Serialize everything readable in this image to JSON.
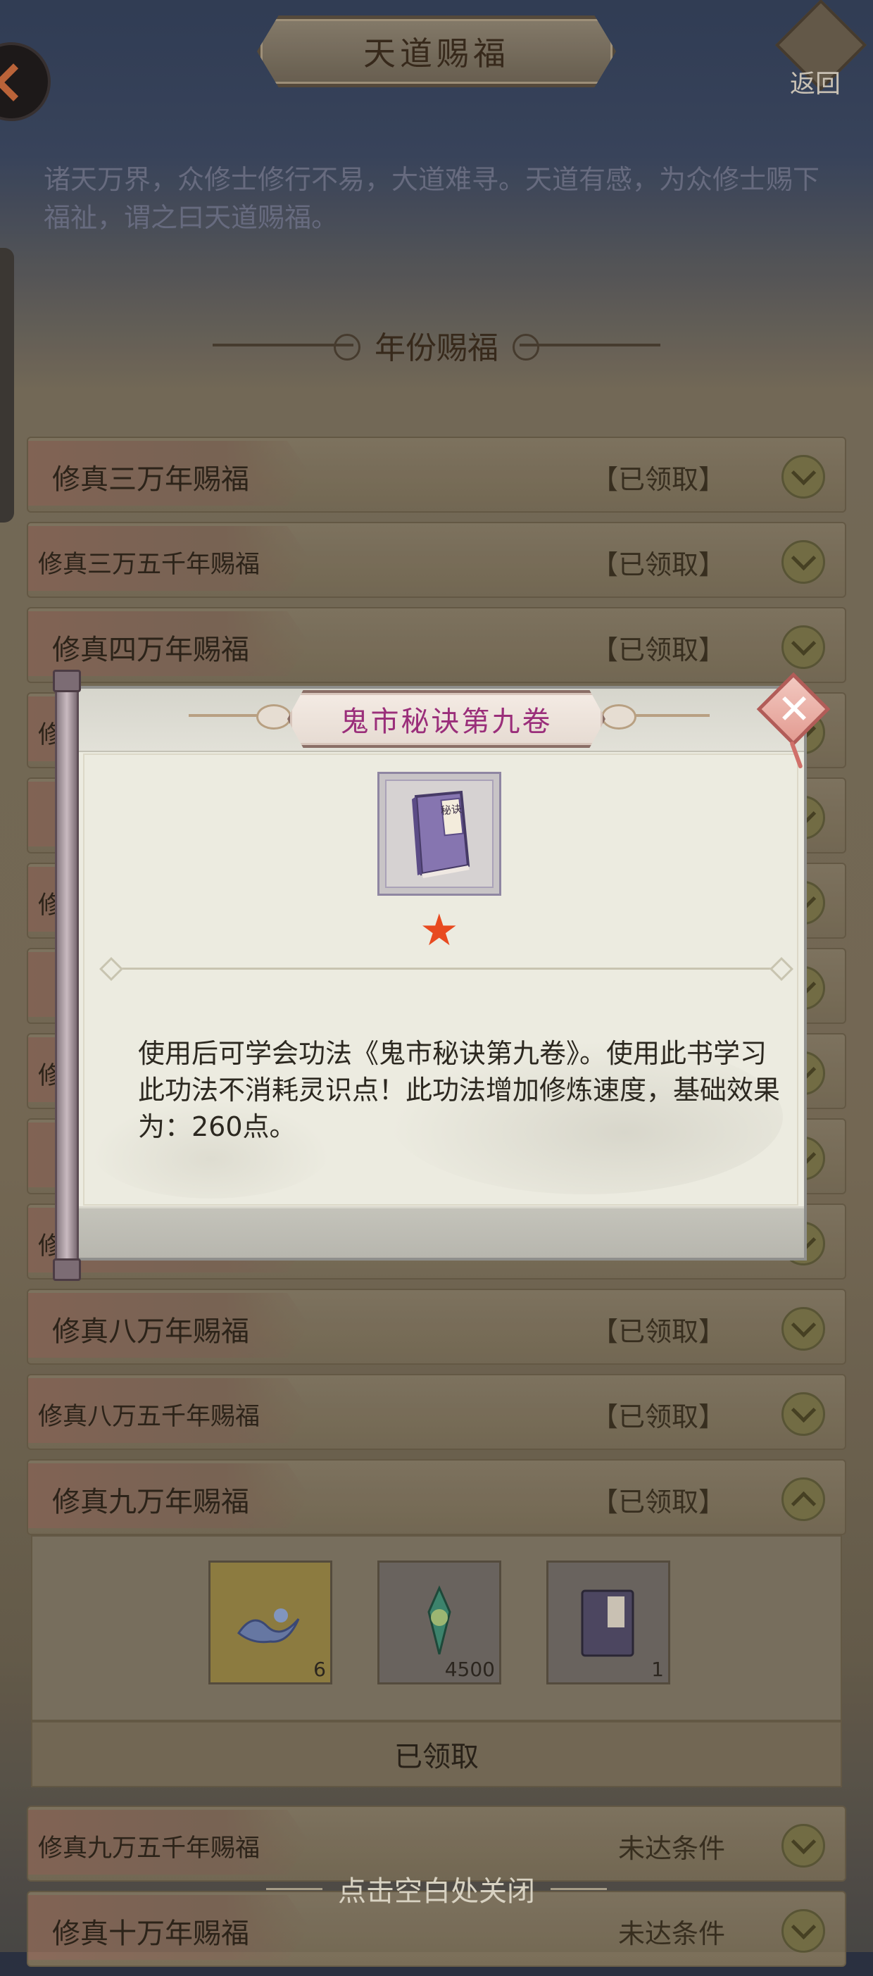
{
  "header": {
    "title": "天道赐福",
    "back_label": "返回"
  },
  "intro_text": "诸天万界，众修士修行不易，大道难寻。天道有感，为众修士赐下福祉，谓之曰天道赐福。",
  "section_title": "年份赐福",
  "rows": [
    {
      "name": "修真三万年赐福",
      "status": "【已领取】"
    },
    {
      "name": "修真三万五千年赐福",
      "status": "【已领取】"
    },
    {
      "name": "修真四万年赐福",
      "status": "【已领取】"
    },
    {
      "name": "修",
      "status": ""
    },
    {
      "name": "",
      "status": ""
    },
    {
      "name": "修",
      "status": ""
    },
    {
      "name": "",
      "status": ""
    },
    {
      "name": "修",
      "status": ""
    },
    {
      "name": "",
      "status": ""
    },
    {
      "name": "修",
      "status": ""
    },
    {
      "name": "修真八万年赐福",
      "status": "【已领取】"
    },
    {
      "name": "修真八万五千年赐福",
      "status": "【已领取】"
    },
    {
      "name": "修真九万年赐福",
      "status": "【已领取】"
    }
  ],
  "rewards": [
    {
      "icon": "wave-icon",
      "qty": "6"
    },
    {
      "icon": "jade-ornament-icon",
      "qty": "4500"
    },
    {
      "icon": "book-icon",
      "qty": "1"
    }
  ],
  "claimed_label": "已领取",
  "rows_after": [
    {
      "name": "修真九万五千年赐福",
      "status": "未达条件"
    },
    {
      "name": "修真十万年赐福",
      "status": "未达条件"
    }
  ],
  "close_hint": "点击空白处关闭",
  "modal": {
    "item_name": "鬼市秘诀第九卷",
    "book_label": "秘诀",
    "description": "使用后可学会功法《鬼市秘诀第九卷》。使用此书学习此功法不消耗灵识点！此功法增加修炼速度，基础效果为：260点。",
    "rarity_stars": 1
  },
  "colors": {
    "item_name": "#9a2e7a",
    "star": "#e84a20"
  }
}
